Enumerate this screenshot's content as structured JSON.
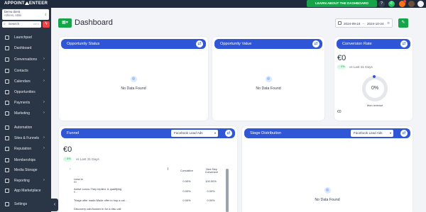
{
  "topbar": {
    "logo": "APPOINT",
    "logo_rest": "ENTEER",
    "learn_button": "LEARN ABOUT THE DASHBOARD",
    "help_icon": "?",
    "phone_icon": "✆",
    "bell_icon": "🔔",
    "avatar_icon": "●"
  },
  "sidebar": {
    "location_name": "Demo client",
    "location_city": "Athens, Attiki",
    "search_placeholder": "Search",
    "search_shortcut": "ctrl K",
    "items": [
      {
        "label": "Launchpad",
        "chevron": ""
      },
      {
        "label": "Dashboard",
        "chevron": ""
      },
      {
        "label": "Conversations",
        "chevron": "›"
      },
      {
        "label": "Contacts",
        "chevron": "›"
      },
      {
        "label": "Calendars",
        "chevron": "›"
      },
      {
        "label": "Opportunities",
        "chevron": ""
      },
      {
        "label": "Payments",
        "chevron": "›"
      },
      {
        "label": "Marketing",
        "chevron": "›"
      },
      {
        "label": "Automation",
        "chevron": ""
      },
      {
        "label": "Sites & Funnels",
        "chevron": "›"
      },
      {
        "label": "Reputation",
        "chevron": "›"
      },
      {
        "label": "Memberships",
        "chevron": ""
      },
      {
        "label": "Media Storage",
        "chevron": ""
      },
      {
        "label": "Reporting",
        "chevron": "›"
      },
      {
        "label": "App Marketplace",
        "chevron": ""
      },
      {
        "label": "Settings",
        "chevron": ""
      }
    ],
    "collapse_icon": "‹"
  },
  "header": {
    "title": "Dashboard",
    "date_from": "2024-09-24",
    "date_to": "2024-10-24",
    "arrow": "→"
  },
  "cards": {
    "opportunity_status": {
      "title": "Opportunity Status",
      "empty": "No Data Found"
    },
    "opportunity_value": {
      "title": "Opportunity Value",
      "empty": "No Data Found"
    },
    "conversion_rate": {
      "title": "Conversion Rate",
      "value": "€0",
      "change": "↑ 0%",
      "compare": "vs Last 31 Days",
      "donut_percent": "0%",
      "donut_label": "Won revenue",
      "footer_value": "€0"
    },
    "funnel": {
      "title": "Funnel",
      "source": "Facebook Lead Ads",
      "value": "€0",
      "change": "↑ 0%",
      "compare": "vs Last 31 Days",
      "col_headers": [
        "Cumulative",
        "Next Step Conversion"
      ],
      "rows": [
        {
          "stage": "Lead in",
          "sub": "€0",
          "cumulative": "0.00%",
          "next": "100.00%"
        },
        {
          "stage": "Active convo-They replied, & qualifying",
          "sub": "€...",
          "cumulative": "0.00%",
          "next": "0.00%"
        },
        {
          "stage": "Triage offer made-Made offer to hop a cal...",
          "sub": "",
          "cumulative": "0.00%",
          "next": "0.00%"
        },
        {
          "stage": "Discovery call-Booked in for a disc call",
          "sub": "",
          "cumulative": "",
          "next": ""
        }
      ]
    },
    "stage_distribution": {
      "title": "Stage Distribution",
      "source": "Facebook Lead Ads",
      "empty": "No Data Found"
    }
  },
  "colors": {
    "brand_blue": "#2f56d6",
    "brand_green": "#16a34a",
    "sidebar_bg": "#2a3646"
  }
}
